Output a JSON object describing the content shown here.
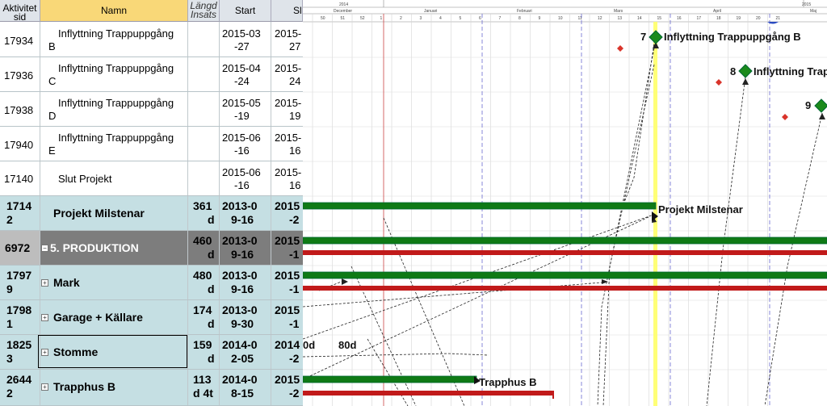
{
  "columns": {
    "id": "Aktivitetsid",
    "name": "Namn",
    "length": "Längd Insats",
    "start": "Start",
    "s": "Sl"
  },
  "rows": [
    {
      "id": "17934",
      "name": "Inflyttning Trappuppgång",
      "name2": "B",
      "start1": "2015-03",
      "start2": "-27",
      "s1": "2015-",
      "s2": "27"
    },
    {
      "id": "17936",
      "name": "Inflyttning Trappuppgång",
      "name2": "C",
      "start1": "2015-04",
      "start2": "-24",
      "s1": "2015-",
      "s2": "24"
    },
    {
      "id": "17938",
      "name": "Inflyttning Trappuppgång",
      "name2": "D",
      "start1": "2015-05",
      "start2": "-19",
      "s1": "2015-",
      "s2": "19"
    },
    {
      "id": "17940",
      "name": "Inflyttning Trappuppgång",
      "name2": "E",
      "start1": "2015-06",
      "start2": "-16",
      "s1": "2015-",
      "s2": "16"
    },
    {
      "id": "17140",
      "name": "Slut Projekt",
      "start1": "2015-06",
      "start2": "-16",
      "s1": "2015-",
      "s2": "16"
    },
    {
      "id1": "1714",
      "id2": "2",
      "name": "Projekt Milstenar",
      "len1": "361",
      "len2": "d",
      "start1": "2013-0",
      "start2": "9-16",
      "s1": "2015",
      "s2": "-2"
    },
    {
      "id": "6972",
      "name": "5. PRODUKTION",
      "expander": "−",
      "len1": "460",
      "len2": "d",
      "start1": "2013-0",
      "start2": "9-16",
      "s1": "2015",
      "s2": "-1"
    },
    {
      "id1": "1797",
      "id2": "9",
      "name": "Mark",
      "expander": "+",
      "len1": "480",
      "len2": "d",
      "start1": "2013-0",
      "start2": "9-16",
      "s1": "2015",
      "s2": "-1"
    },
    {
      "id1": "1798",
      "id2": "1",
      "name": "Garage + Källare",
      "expander": "+",
      "len1": "174",
      "len2": "d",
      "start1": "2013-0",
      "start2": "9-30",
      "s1": "2015",
      "s2": "-1"
    },
    {
      "id1": "1825",
      "id2": "3",
      "name": "Stomme",
      "expander": "+",
      "len1": "159",
      "len2": "d",
      "start1": "2014-0",
      "start2": "2-05",
      "s1": "2014",
      "s2": "-2"
    },
    {
      "id1": "2644",
      "id2": "2",
      "name": "Trapphus B",
      "expander": "+",
      "len1": "113",
      "len2": "d 4t",
      "start1": "2014-0",
      "start2": "8-15",
      "s1": "2015",
      "s2": "-2"
    }
  ],
  "timeline": {
    "year_left": "2014",
    "year_right": "2015",
    "year_right_short": "2015",
    "months": [
      "December",
      "Januari",
      "Februari",
      "Mars",
      "April",
      "Maj"
    ],
    "weeks": [
      "50",
      "51",
      "52",
      "1",
      "2",
      "3",
      "4",
      "5",
      "6",
      "7",
      "8",
      "9",
      "10",
      "11",
      "12",
      "13",
      "14",
      "15",
      "16",
      "17",
      "18",
      "19",
      "20",
      "21"
    ]
  },
  "gantt_labels": {
    "milestone_b": "Inflyttning Trappuppgång B",
    "milestone_c": "Inflyttning Trap",
    "num_7": "7",
    "num_8": "8",
    "num_9": "9",
    "projekt": "Projekt Milstenar",
    "trapphus": "Trapphus B",
    "dur_a": "0d",
    "dur_b": "80d"
  },
  "colors": {
    "green_bar": "#0f7a15",
    "red_bar": "#c11a1a",
    "today_line": "#ffff66",
    "milestone": "#1b8a1b",
    "red_diamond": "#d9342b"
  }
}
